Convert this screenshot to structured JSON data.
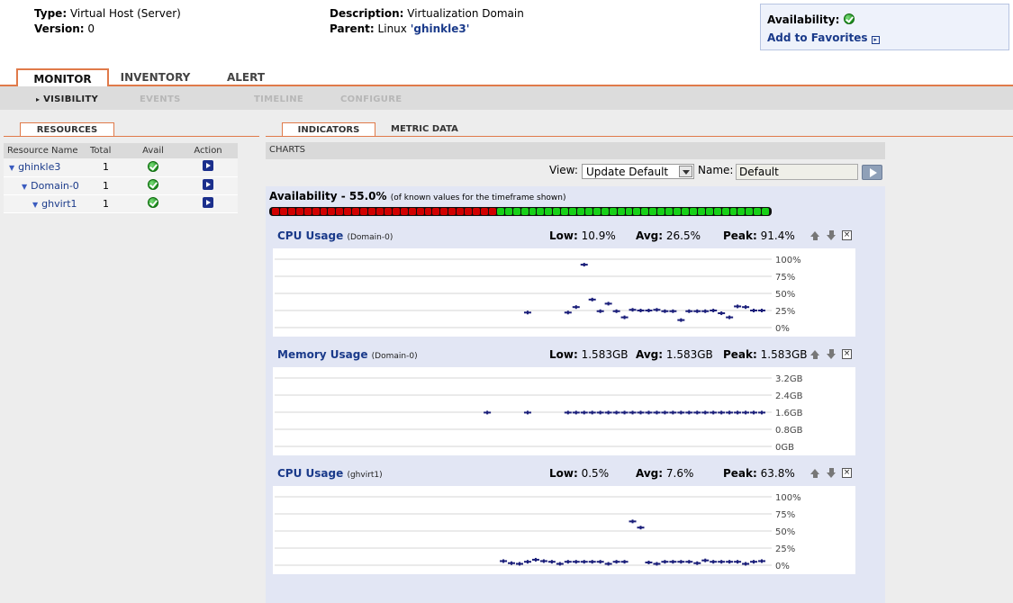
{
  "header": {
    "type_label": "Type:",
    "type_value": "Virtual Host (Server)",
    "version_label": "Version:",
    "version_value": "0",
    "description_label": "Description:",
    "description_value": "Virtualization Domain",
    "parent_label": "Parent:",
    "parent_prefix": "Linux",
    "parent_link": "'ghinkle3'",
    "availability_label": "Availability:",
    "favorites_label": "Add to Favorites"
  },
  "main_tabs": [
    {
      "label": "MONITOR",
      "active": true
    },
    {
      "label": "INVENTORY",
      "active": false
    },
    {
      "label": "ALERT",
      "active": false
    }
  ],
  "sub_tabs": [
    {
      "label": "VISIBILITY",
      "active": true
    },
    {
      "label": "EVENTS",
      "active": false
    },
    {
      "label": "TIMELINE",
      "active": false
    },
    {
      "label": "CONFIGURE",
      "active": false
    }
  ],
  "resources": {
    "tab_label": "RESOURCES",
    "columns": [
      "Resource Name",
      "Total",
      "Avail",
      "Action"
    ],
    "rows": [
      {
        "name": "ghinkle3",
        "total": "1",
        "avail_icon": "ok-icon",
        "action_icon": "play-icon"
      },
      {
        "name": "Domain-0",
        "total": "1",
        "avail_icon": "ok-icon",
        "action_icon": "play-icon"
      },
      {
        "name": "ghvirt1",
        "total": "1",
        "avail_icon": "ok-icon",
        "action_icon": "play-icon"
      }
    ]
  },
  "indicators": {
    "tab_label": "INDICATORS",
    "metric_tab_label": "METRIC DATA",
    "charts_label": "CHARTS",
    "view_label": "View:",
    "view_value": "Update Default",
    "name_label": "Name:",
    "name_value": "Default",
    "availability_title": "Availability - 55.0%",
    "availability_note": "(of known values for the timeframe shown)",
    "availability_pct": 55.0
  },
  "chart_data": [
    {
      "type": "scatter",
      "title": "CPU Usage",
      "subtitle": "(Domain-0)",
      "low_label": "Low:",
      "low": "10.9%",
      "avg_label": "Avg:",
      "avg": "26.5%",
      "peak_label": "Peak:",
      "peak": "91.4%",
      "yticks": [
        "100%",
        "75%",
        "50%",
        "25%",
        "0%"
      ],
      "ylim": [
        0,
        100
      ],
      "xlim": [
        0,
        60
      ],
      "points": [
        [
          31,
          22
        ],
        [
          36,
          22
        ],
        [
          37,
          30
        ],
        [
          38,
          92
        ],
        [
          39,
          41
        ],
        [
          40,
          24
        ],
        [
          41,
          35
        ],
        [
          42,
          24
        ],
        [
          43,
          15
        ],
        [
          44,
          26
        ],
        [
          45,
          25
        ],
        [
          46,
          25
        ],
        [
          47,
          26
        ],
        [
          48,
          24
        ],
        [
          49,
          24
        ],
        [
          50,
          11
        ],
        [
          51,
          24
        ],
        [
          52,
          24
        ],
        [
          53,
          24
        ],
        [
          54,
          25
        ],
        [
          55,
          21
        ],
        [
          56,
          15
        ],
        [
          57,
          31
        ],
        [
          58,
          30
        ],
        [
          59,
          25
        ],
        [
          60,
          25
        ]
      ]
    },
    {
      "type": "scatter",
      "title": "Memory Usage",
      "subtitle": "(Domain-0)",
      "low_label": "Low:",
      "low": "1.583GB",
      "avg_label": "Avg:",
      "avg": "1.583GB",
      "peak_label": "Peak:",
      "peak": "1.583GB",
      "yticks": [
        "3.2GB",
        "2.4GB",
        "1.6GB",
        "0.8GB",
        "0GB"
      ],
      "ylim": [
        0,
        3.2
      ],
      "xlim": [
        0,
        60
      ],
      "points": [
        [
          26,
          1.583
        ],
        [
          31,
          1.583
        ],
        [
          36,
          1.583
        ],
        [
          37,
          1.583
        ],
        [
          38,
          1.583
        ],
        [
          39,
          1.583
        ],
        [
          40,
          1.583
        ],
        [
          41,
          1.583
        ],
        [
          42,
          1.583
        ],
        [
          43,
          1.583
        ],
        [
          44,
          1.583
        ],
        [
          45,
          1.583
        ],
        [
          46,
          1.583
        ],
        [
          47,
          1.583
        ],
        [
          48,
          1.583
        ],
        [
          49,
          1.583
        ],
        [
          50,
          1.583
        ],
        [
          51,
          1.583
        ],
        [
          52,
          1.583
        ],
        [
          53,
          1.583
        ],
        [
          54,
          1.583
        ],
        [
          55,
          1.583
        ],
        [
          56,
          1.583
        ],
        [
          57,
          1.583
        ],
        [
          58,
          1.583
        ],
        [
          59,
          1.583
        ],
        [
          60,
          1.583
        ]
      ]
    },
    {
      "type": "scatter",
      "title": "CPU Usage",
      "subtitle": "(ghvirt1)",
      "low_label": "Low:",
      "low": "0.5%",
      "avg_label": "Avg:",
      "avg": "7.6%",
      "peak_label": "Peak:",
      "peak": "63.8%",
      "yticks": [
        "100%",
        "75%",
        "50%",
        "25%",
        "0%"
      ],
      "ylim": [
        0,
        100
      ],
      "xlim": [
        0,
        60
      ],
      "points": [
        [
          28,
          6
        ],
        [
          29,
          3
        ],
        [
          30,
          2
        ],
        [
          31,
          5
        ],
        [
          32,
          8
        ],
        [
          33,
          6
        ],
        [
          34,
          5
        ],
        [
          35,
          2
        ],
        [
          36,
          5
        ],
        [
          37,
          5
        ],
        [
          38,
          5
        ],
        [
          39,
          5
        ],
        [
          40,
          5
        ],
        [
          41,
          2
        ],
        [
          42,
          5
        ],
        [
          43,
          5
        ],
        [
          44,
          64
        ],
        [
          45,
          55
        ],
        [
          46,
          4
        ],
        [
          47,
          2
        ],
        [
          48,
          5
        ],
        [
          49,
          5
        ],
        [
          50,
          5
        ],
        [
          51,
          5
        ],
        [
          52,
          3
        ],
        [
          53,
          7
        ],
        [
          54,
          5
        ],
        [
          55,
          5
        ],
        [
          56,
          5
        ],
        [
          57,
          5
        ],
        [
          58,
          2
        ],
        [
          59,
          5
        ],
        [
          60,
          6
        ]
      ]
    }
  ]
}
